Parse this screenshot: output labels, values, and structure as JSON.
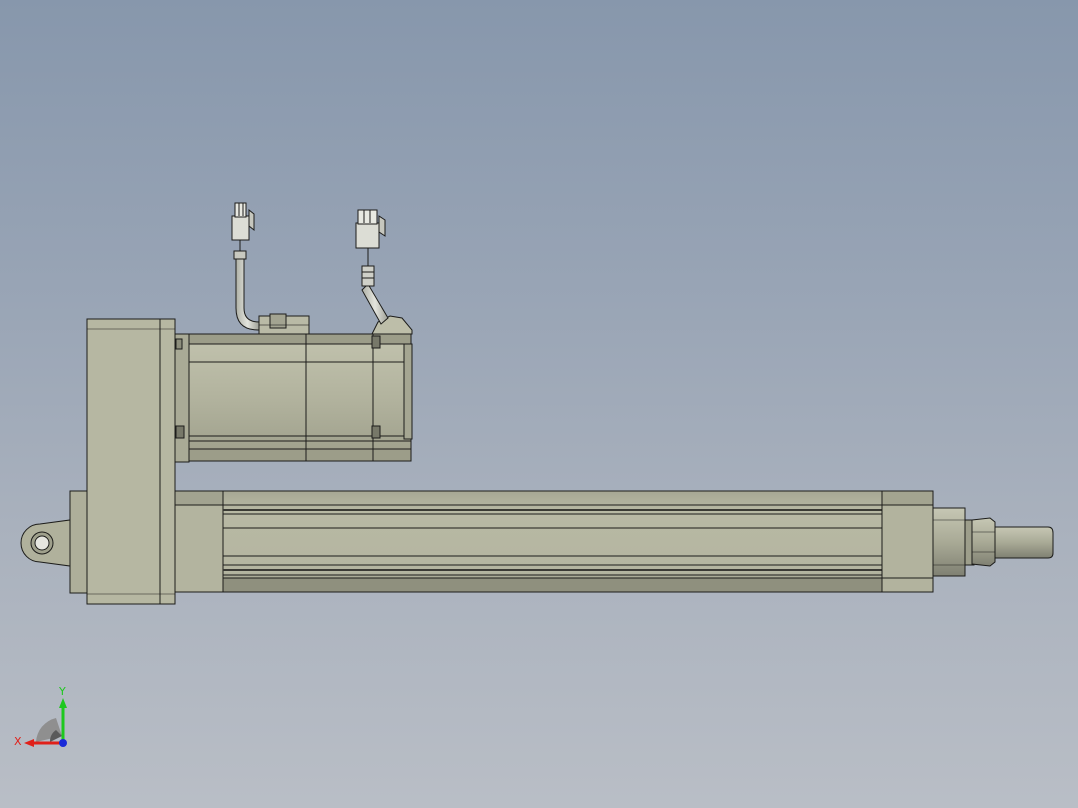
{
  "viewport": {
    "background_top": "#8797ac",
    "background_bottom": "#b9bec6"
  },
  "model": {
    "body_fill": "#b3b49f",
    "body_shadow": "#8f907e",
    "body_dark": "#6b6c60",
    "edge_color": "#1c1c1a",
    "connector_fill": "#cfd0c6"
  },
  "triad": {
    "x_label": "X",
    "y_label": "Y",
    "x_color": "#e0201a",
    "y_color": "#1ec81e",
    "z_color": "#1a2ad8"
  }
}
